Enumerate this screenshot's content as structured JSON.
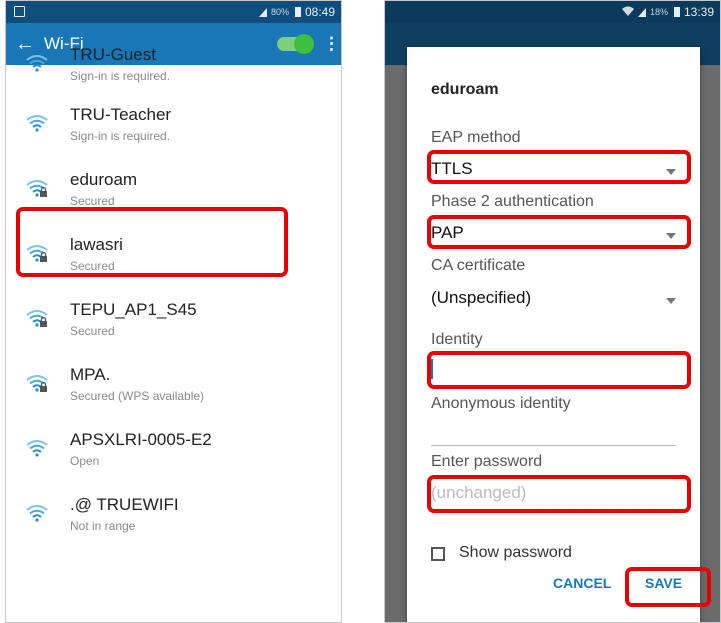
{
  "left": {
    "status": {
      "pct": "80%",
      "time": "08:49"
    },
    "appbar": {
      "back": "←",
      "title": "Wi-Fi",
      "menu": "⋮"
    },
    "networks": [
      {
        "ssid": "TRU-Guest",
        "sub": "Sign-in is required.",
        "secured": false
      },
      {
        "ssid": "TRU-Teacher",
        "sub": "Sign-in is required.",
        "secured": false
      },
      {
        "ssid": "eduroam",
        "sub": "Secured",
        "secured": true
      },
      {
        "ssid": "lawasri",
        "sub": "Secured",
        "secured": true
      },
      {
        "ssid": "TEPU_AP1_S45",
        "sub": "Secured",
        "secured": true
      },
      {
        "ssid": "MPA.",
        "sub": "Secured (WPS available)",
        "secured": true
      },
      {
        "ssid": "APSXLRI-0005-E2",
        "sub": "Open",
        "secured": false
      },
      {
        "ssid": ".@ TRUEWIFI",
        "sub": "Not in range",
        "secured": false
      }
    ]
  },
  "right": {
    "status": {
      "pct": "18%",
      "time": "13:39"
    },
    "dialog": {
      "title": "eduroam",
      "eap_label": "EAP method",
      "eap_value": "TTLS",
      "phase2_label": "Phase 2 authentication",
      "phase2_value": "PAP",
      "ca_label": "CA certificate",
      "ca_value": "(Unspecified)",
      "identity_label": "Identity",
      "identity_value": "",
      "anon_label": "Anonymous identity",
      "pw_label": "Enter password",
      "pw_placeholder": "(unchanged)",
      "show_password": "Show password",
      "cancel": "CANCEL",
      "save": "SAVE"
    }
  },
  "colors": {
    "accent": "#1976b7",
    "status_bar": "#0f4e7c",
    "highlight": "#e60000",
    "toggle": "#3fbf3f"
  }
}
